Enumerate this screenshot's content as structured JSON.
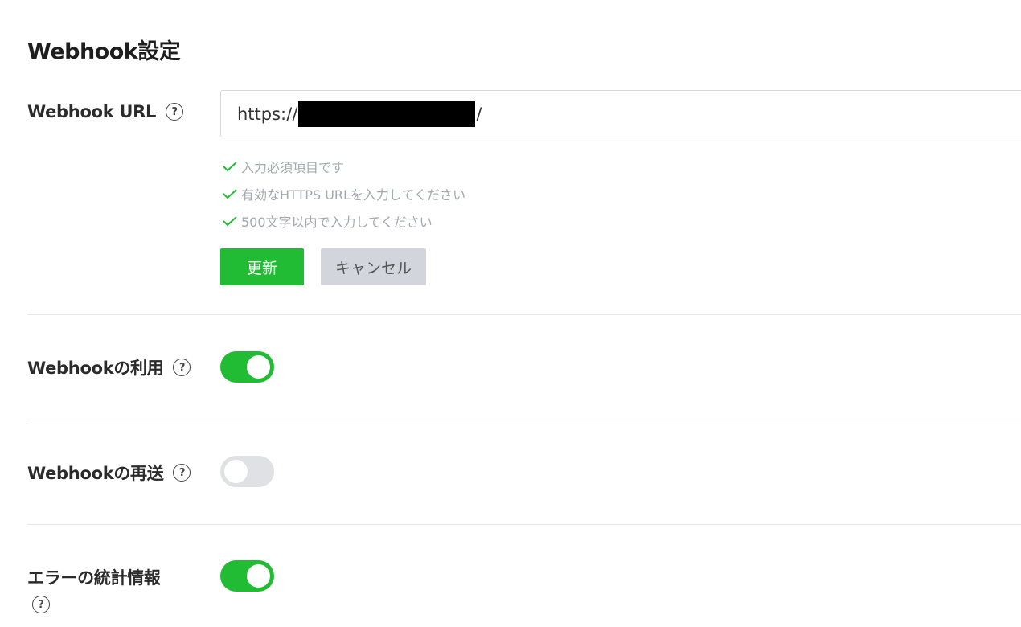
{
  "section": {
    "title": "Webhook設定"
  },
  "webhook_url": {
    "label": "Webhook URL",
    "value_prefix": "https://",
    "value_suffix": "/",
    "help": "?",
    "rules": [
      "入力必須項目です",
      "有効なHTTPS URLを入力してください",
      "500文字以内で入力してください"
    ]
  },
  "buttons": {
    "update": "更新",
    "cancel": "キャンセル"
  },
  "settings": [
    {
      "label": "Webhookの利用",
      "enabled": true,
      "help": "?"
    },
    {
      "label": "Webhookの再送",
      "enabled": false,
      "help": "?"
    },
    {
      "label": "エラーの統計情報",
      "enabled": true,
      "help": "?"
    }
  ],
  "colors": {
    "accent": "#22bb34",
    "toggle_off": "#dfe1e5",
    "rule_text": "#a4a8b0"
  }
}
